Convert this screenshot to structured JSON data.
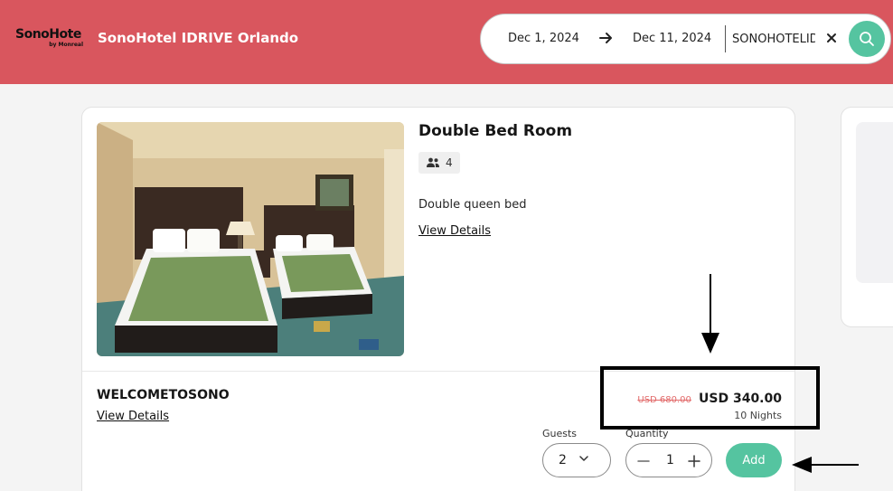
{
  "header": {
    "logo_main": "SonoHote",
    "logo_sub": "by Monreal",
    "hotel_name": "SonoHotel IDRIVE Orlando",
    "checkin_date": "Dec 1, 2024",
    "checkout_date": "Dec 11, 2024",
    "promo_code_value": "SONOHOTELIDRIVE",
    "brand_color": "#d9565e",
    "accent_color": "#55c4a0"
  },
  "room": {
    "title": "Double Bed Room",
    "max_guests": "4",
    "bed_description": "Double queen bed",
    "view_details": "View Details"
  },
  "rate": {
    "name": "WELCOMETOSONO",
    "view_details": "View Details",
    "original_price": "USD 680.00",
    "price": "USD 340.00",
    "nights": "10 Nights",
    "guests_label": "Guests",
    "guests_value": "2",
    "quantity_label": "Quantity",
    "quantity_value": "1",
    "add_label": "Add"
  }
}
